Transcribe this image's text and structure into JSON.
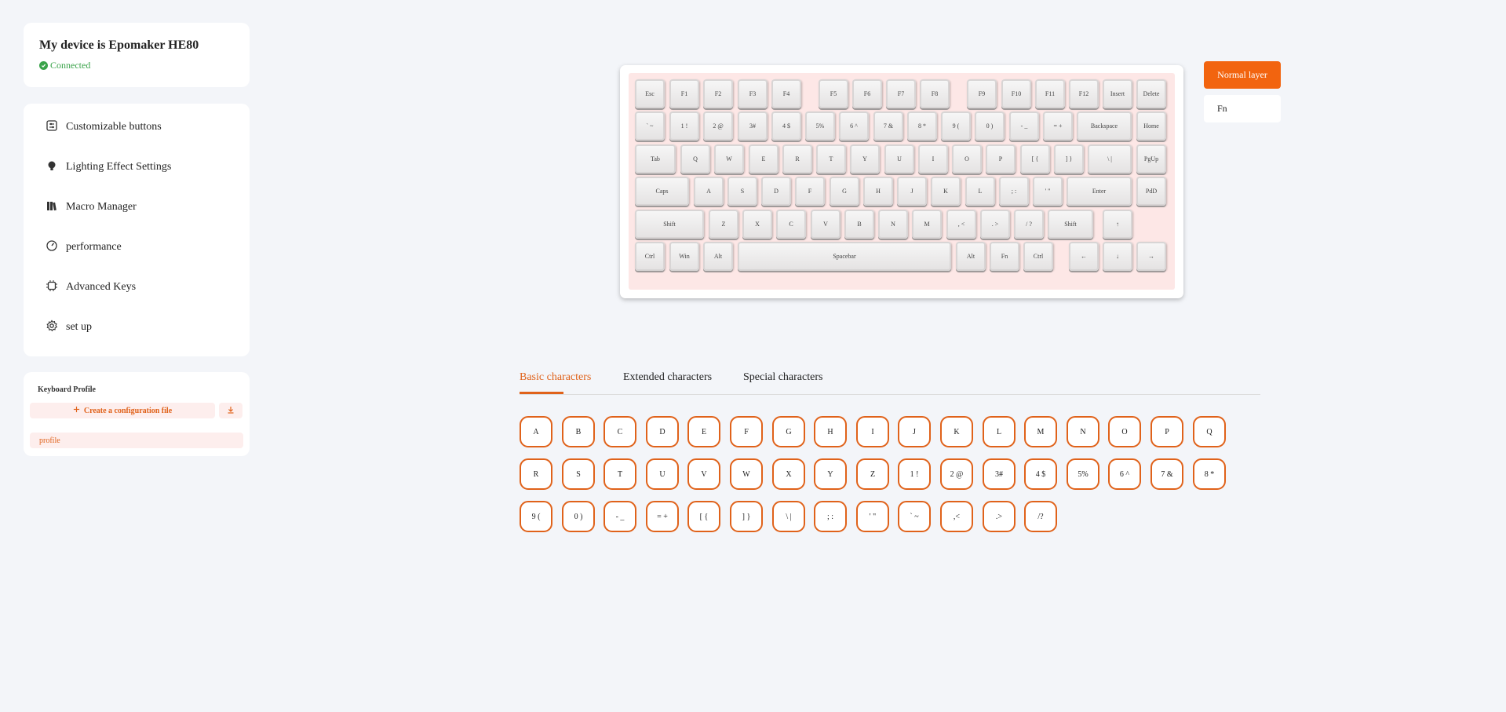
{
  "device": {
    "title": "My device is Epomaker HE80",
    "status": "Connected"
  },
  "menu": [
    {
      "label": "Customizable buttons",
      "icon": "sliders-icon"
    },
    {
      "label": "Lighting Effect Settings",
      "icon": "bulb-icon"
    },
    {
      "label": "Macro Manager",
      "icon": "books-icon"
    },
    {
      "label": "performance",
      "icon": "gauge-icon"
    },
    {
      "label": "Advanced Keys",
      "icon": "chip-icon"
    },
    {
      "label": "set up",
      "icon": "gear-icon"
    }
  ],
  "profile": {
    "heading": "Keyboard Profile",
    "create_label": "Create a configuration file",
    "item": "profile"
  },
  "layers": {
    "normal": "Normal layer",
    "fn": "Fn"
  },
  "keyboard_rows": [
    [
      "Esc",
      "F1",
      "F2",
      "F3",
      "F4",
      "F5",
      "F6",
      "F7",
      "F8",
      "F9",
      "F10",
      "F11",
      "F12",
      "Insert",
      "Delete"
    ],
    [
      "` ~",
      "1 !",
      "2 @",
      "3#",
      "4 $",
      "5%",
      "6 ^",
      "7 &",
      "8 *",
      "9 (",
      "0 )",
      "- _",
      "= +",
      "Backspace",
      "Home"
    ],
    [
      "Tab",
      "Q",
      "W",
      "E",
      "R",
      "T",
      "Y",
      "U",
      "I",
      "O",
      "P",
      "[ {",
      "] }",
      "\\ |",
      "PgUp"
    ],
    [
      "Caps",
      "A",
      "S",
      "D",
      "F",
      "G",
      "H",
      "J",
      "K",
      "L",
      "; :",
      "' \"",
      "Enter",
      "PdD"
    ],
    [
      "Shift",
      "Z",
      "X",
      "C",
      "V",
      "B",
      "N",
      "M",
      ", <",
      ". >",
      "/ ?",
      "Shift",
      "↑"
    ],
    [
      "Ctrl",
      "Win",
      "Alt",
      "Spacebar",
      "Alt",
      "Fn",
      "Ctrl",
      "←",
      "↓",
      "→"
    ]
  ],
  "tabs": [
    "Basic characters",
    "Extended characters",
    "Special characters"
  ],
  "characters": [
    [
      "A",
      "B",
      "C",
      "D",
      "E",
      "F",
      "G",
      "H",
      "I",
      "J",
      "K",
      "L",
      "M",
      "N",
      "O",
      "P",
      "Q"
    ],
    [
      "R",
      "S",
      "T",
      "U",
      "V",
      "W",
      "X",
      "Y",
      "Z",
      "1 !",
      "2 @",
      "3#",
      "4 $",
      "5%",
      "6 ^",
      "7 &",
      "8 *"
    ],
    [
      "9 (",
      "0 )",
      "- _",
      "= +",
      "[ {",
      "] }",
      "\\ |",
      "; :",
      "' \"",
      "` ~",
      ",<",
      ".>",
      "/?"
    ]
  ],
  "colors": {
    "accent": "#e0621a",
    "layer_active": "#f2640f",
    "connected": "#3aa34a",
    "plate": "#fde7e6"
  }
}
